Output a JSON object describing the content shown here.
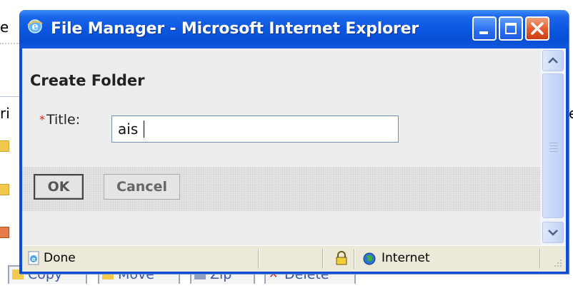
{
  "background": {
    "fragments": {
      "top_left": "e",
      "mid_left": "ri",
      "mid_right": "e"
    },
    "toolbar": [
      {
        "label": "Copy"
      },
      {
        "label": "Move"
      },
      {
        "label": "Zip"
      },
      {
        "label": "Delete"
      }
    ]
  },
  "window": {
    "title": "File Manager - Microsoft Internet Explorer",
    "controls": [
      "minimize",
      "maximize",
      "close"
    ]
  },
  "form": {
    "heading": "Create Folder",
    "required_marker": "*",
    "title_label": "Title:",
    "title_value": "ais",
    "ok_label": "OK",
    "cancel_label": "Cancel"
  },
  "statusbar": {
    "status": "Done",
    "zone": "Internet"
  },
  "colors": {
    "titlebar": "#0a55de",
    "close_button": "#e25b2e",
    "required": "#dd2222"
  }
}
